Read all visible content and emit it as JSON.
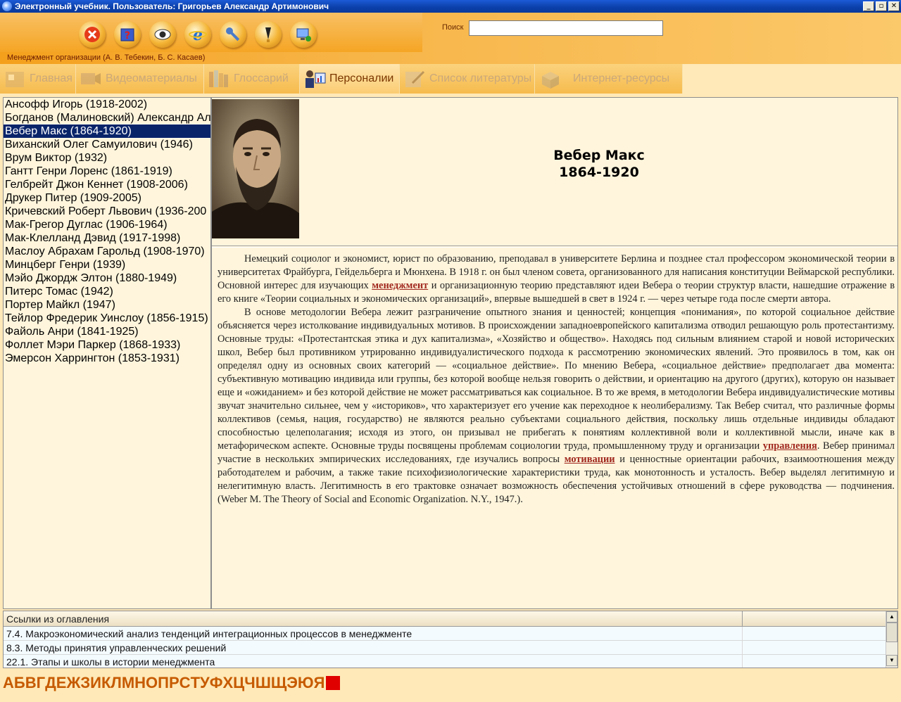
{
  "window": {
    "title": "Электронный учебник. Пользователь: Григорьев Александр Артимонович",
    "buttons": [
      "_",
      "▫",
      "✕"
    ]
  },
  "header": {
    "book_title": "Менеджмент организации (А. В. Тебекин, Б. С. Касаев)",
    "search": {
      "label": "Поиск",
      "value": "",
      "placeholder": ""
    },
    "toolbar_icons": [
      "exit-icon",
      "help-icon",
      "view-icon",
      "browser-icon",
      "settings-key-icon",
      "notes-pen-icon",
      "network-icon"
    ]
  },
  "tabs": [
    {
      "label": "Главная",
      "active": false
    },
    {
      "label": "Видеоматериалы",
      "active": false
    },
    {
      "label": "Глоссарий",
      "active": false
    },
    {
      "label": "Персоналии",
      "active": true
    },
    {
      "label": "Список литературы",
      "active": false
    },
    {
      "label": "Интернет-ресурсы",
      "active": false
    }
  ],
  "persons": [
    "Ансофф Игорь  (1918-2002)",
    "Богданов (Малиновский) Александр Ал",
    "Вебер Макс  (1864-1920)",
    "Виханский Олег Самуилович (1946)",
    "Врум Виктор  (1932)",
    "Гантт Генри Лоренс (1861-1919)",
    "Гелбрейт Джон Кеннет  (1908-2006)",
    "Друкер Питер  (1909-2005)",
    "Кричевский Роберт Львович (1936-200",
    "Мак-Грегор Дуглас  (1906-1964)",
    "Мак-Клелланд Дэвид  (1917-1998)",
    "Маслоу Абрахам Гарольд (1908-1970)",
    "Минцберг Генри  (1939)",
    "Мэйо Джордж Элтон (1880-1949)",
    "Питерс Томас  (1942)",
    "Портер Майкл  (1947)",
    "Тейлор Фредерик Уинслоу (1856-1915)",
    "Файоль Анри  (1841-1925)",
    "Фоллет Мэри Паркер (1868-1933)",
    "Эмерсон Харрингтон  (1853-1931)"
  ],
  "selected_index": 2,
  "detail": {
    "name": "Вебер Макс",
    "years": "1864-1920",
    "bio": {
      "p1_a": "Немецкий социолог и экономист, юрист по образованию, преподавал в университете Берлина и позднее стал профессором экономической теории в университетах Фрайбурга, Гейдельберга и Мюнхена. В 1918 г. он был членом совета, организованного для написания конституции Веймарской республики. Основной интерес для изучающих ",
      "link_1": "менеджмент",
      "p1_b": " и организационную теорию представляют идеи Вебера о теории структур власти, нашедшие отражение в его книге «Теории социальных и экономических организаций», впервые вышедшей в свет в 1924 г. — через четыре года после смерти автора.",
      "p2_a": "В основе методологии Вебера лежит разграничение опытного знания и ценностей; концепция «понимания», по которой социальное действие объясняется через истолкование индивидуальных мотивов. В происхождении западноевропейского капитализма отводил решающую роль протестантизму. Основные труды: «Протестантская этика и дух капитализма», «Хозяйство и общество». Находясь под сильным влиянием старой и новой исторических школ, Вебер был противником утрированно индивидуалистического подхода к рассмотрению экономических явлений. Это проявилось в том, как он определял одну из основных своих категорий — «социальное действие». По мнению Вебера, «социальное действие» предполагает два момента: субъективную мотивацию индивида или группы, без которой вообще нельзя говорить о действии, и ориентацию на другого (других), которую он называет еще и «ожиданием» и без которой действие не может рассматриваться как социальное. В то же время, в методологии Вебера индивидуалистические мотивы звучат значительно сильнее, чем у «историков», что характеризует его учение как переходное к неолиберализму. Так Вебер считал, что различные формы коллективов (семья, нация, государство) не являются реально субъектами социального действия, поскольку лишь отдельные индивиды обладают способностью целеполагания; исходя из этого, он призывал не прибегать к понятиям коллективной воли и коллективной мысли, иначе как в метафорическом аспекте. Основные труды посвящены проблемам социологии труда, промышленному труду и организации ",
      "link_2": "управления",
      "p2_b": ". Вебер принимал участие в нескольких эмпирических исследованиях, где изучались вопросы ",
      "link_3": "мотивации",
      "p2_c": " и ценностные ориентации рабочих, взаимоотношения между работодателем и рабочим, а также такие психофизиологические характеристики труда, как монотонность и усталость. Вебер выделял легитимную и нелегитимную власть. Легитимность в его трактовке означает возможность обеспечения устойчивых отношений в сфере руководства — подчинения. (Weber M. The Theory of Social and Economic Organization. N.Y., 1947.)."
    }
  },
  "links_table": {
    "header": "Ссылки из оглавления",
    "rows": [
      "7.4. Макроэкономический анализ тенденций интеграционных процессов в менеджменте",
      "8.3. Методы принятия управленческих решений",
      "22.1. Этапы и школы в истории менеджмента"
    ]
  },
  "alphabet": [
    "А",
    "Б",
    "В",
    "Г",
    "Д",
    "Е",
    "Ж",
    "З",
    "И",
    "К",
    "Л",
    "М",
    "Н",
    "О",
    "П",
    "Р",
    "С",
    "Т",
    "У",
    "Ф",
    "Х",
    "Ц",
    "Ч",
    "Ш",
    "Щ",
    "Э",
    "Ю",
    "Я"
  ],
  "colors": {
    "accent": "#c65a00",
    "selection": "#0a246a",
    "link": "#a0281e",
    "panel": "#fff5dc"
  }
}
